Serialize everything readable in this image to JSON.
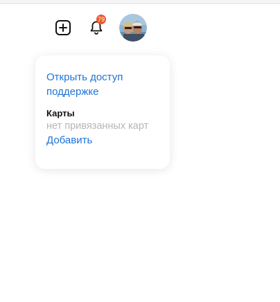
{
  "header": {
    "add_icon": "plus-square-icon",
    "bell_icon": "bell-icon",
    "notification_count": "79",
    "avatar": "user-avatar-photo",
    "badge_color": "#ec5a2c"
  },
  "menu": {
    "support_access_link": "Открыть доступ поддержке",
    "cards_heading": "Карты",
    "cards_empty_text": "нет привязанных карт",
    "add_card_link": "Добавить",
    "link_color": "#1f73d6"
  }
}
